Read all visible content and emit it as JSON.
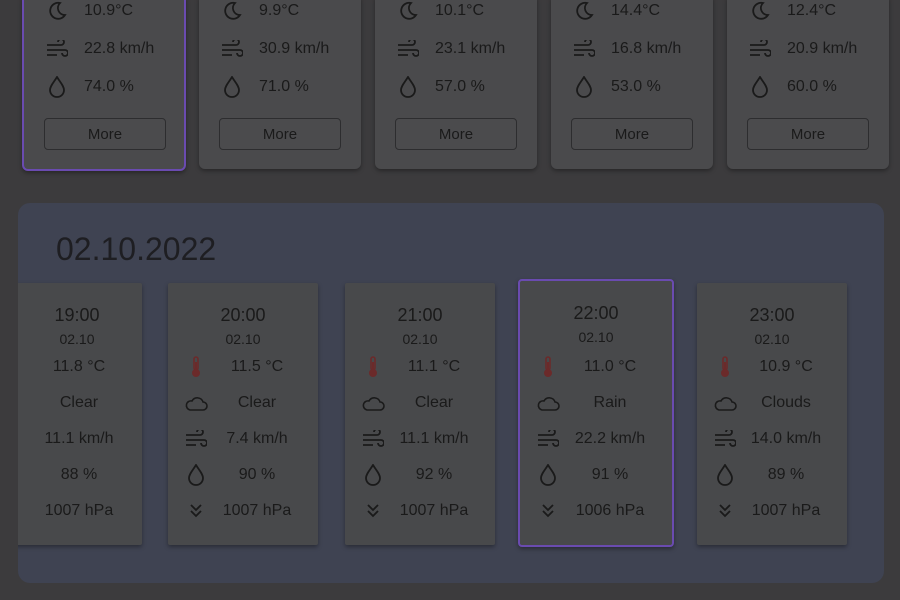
{
  "days": [
    {
      "temp": "10.9°C",
      "wind": "22.8 km/h",
      "humidity": "74.0 %",
      "button": "More",
      "selected": true
    },
    {
      "temp": "9.9°C",
      "wind": "30.9 km/h",
      "humidity": "71.0 %",
      "button": "More",
      "selected": false
    },
    {
      "temp": "10.1°C",
      "wind": "23.1 km/h",
      "humidity": "57.0 %",
      "button": "More",
      "selected": false
    },
    {
      "temp": "14.4°C",
      "wind": "16.8 km/h",
      "humidity": "53.0 %",
      "button": "More",
      "selected": false
    },
    {
      "temp": "12.4°C",
      "wind": "20.9 km/h",
      "humidity": "60.0 %",
      "button": "More",
      "selected": false
    }
  ],
  "panel": {
    "date": "02.10.2022",
    "hours": [
      {
        "time": "19:00",
        "date": "02.10",
        "temp": "11.8 °C",
        "condition": "Clear",
        "wind": "11.1 km/h",
        "humidity": "88 %",
        "pressure": "1007 hPa"
      },
      {
        "time": "20:00",
        "date": "02.10",
        "temp": "11.5 °C",
        "condition": "Clear",
        "wind": "7.4 km/h",
        "humidity": "90 %",
        "pressure": "1007 hPa"
      },
      {
        "time": "21:00",
        "date": "02.10",
        "temp": "11.1 °C",
        "condition": "Clear",
        "wind": "11.1 km/h",
        "humidity": "92 %",
        "pressure": "1007 hPa"
      },
      {
        "time": "22:00",
        "date": "02.10",
        "temp": "11.0 °C",
        "condition": "Rain",
        "wind": "22.2 km/h",
        "humidity": "91 %",
        "pressure": "1006 hPa"
      },
      {
        "time": "23:00",
        "date": "02.10",
        "temp": "10.9 °C",
        "condition": "Clouds",
        "wind": "14.0 km/h",
        "humidity": "89 %",
        "pressure": "1007 hPa"
      }
    ]
  },
  "colors": {
    "selected_border": "#6a4bb0",
    "thermometer": "#6b2a2a"
  }
}
